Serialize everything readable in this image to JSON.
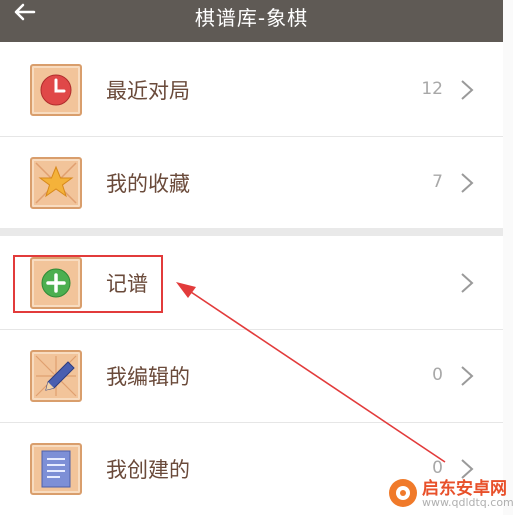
{
  "header": {
    "title": "棋谱库-象棋"
  },
  "rows": [
    {
      "label": "最近对局",
      "count": "12",
      "icon": "clock-icon"
    },
    {
      "label": "我的收藏",
      "count": "7",
      "icon": "star-icon"
    },
    {
      "label": "记谱",
      "count": "",
      "icon": "plus-icon"
    },
    {
      "label": "我编辑的",
      "count": "0",
      "icon": "pencil-icon"
    },
    {
      "label": "我创建的",
      "count": "0",
      "icon": "document-icon"
    }
  ],
  "watermark": {
    "title": "启东安卓网",
    "url": "www.qdldtq.com"
  },
  "colors": {
    "header_bg": "#5f5a55",
    "label": "#6a4a3a",
    "highlight": "#e23b3b"
  }
}
